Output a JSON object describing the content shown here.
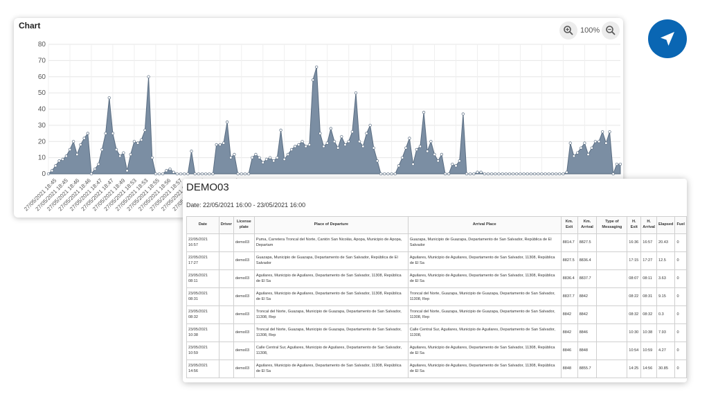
{
  "chart": {
    "title": "Chart",
    "zoom_level": "100%",
    "zoom_in_icon": "zoom-in-icon",
    "zoom_out_icon": "zoom-out-icon"
  },
  "chart_data": {
    "type": "area",
    "title": "Chart",
    "xlabel": "",
    "ylabel": "",
    "ylim": [
      0,
      80
    ],
    "yticks": [
      0,
      10,
      20,
      30,
      40,
      50,
      60,
      70,
      80
    ],
    "grid": true,
    "fill_color": "#7b8ea3",
    "line_color": "#5a6d82",
    "x_tick_labels": [
      "27/05/2021 18:45",
      "27/05/2021 18:45",
      "27/05/2021 18:46",
      "27/05/2021 18:46",
      "27/05/2021 18:47",
      "27/05/2021 18:47",
      "27/05/2021 18:49",
      "27/05/2021 18:53",
      "27/05/2021 18:53",
      "27/05/2021 18:55",
      "27/05/2021 18:56",
      "27/05/2021 18:57",
      "27/05/2021 19:01",
      "27/05/2021 19:05",
      "27/05/2021 19:09",
      "27/05/2021 19:13",
      "27/05/2021 19:17",
      "27/05/2021 19:21"
    ],
    "values": [
      0,
      2,
      5,
      8,
      9,
      11,
      15,
      20,
      12,
      18,
      22,
      25,
      0,
      3,
      6,
      15,
      25,
      47,
      25,
      15,
      11,
      13,
      2,
      12,
      20,
      19,
      21,
      27,
      60,
      10,
      0,
      0,
      0,
      2,
      3,
      1,
      0,
      0,
      0,
      0,
      14,
      0,
      0,
      0,
      0,
      0,
      0,
      18,
      18,
      19,
      32,
      10,
      12,
      0,
      0,
      0,
      0,
      10,
      12,
      10,
      7,
      9,
      10,
      8,
      10,
      27,
      9,
      12,
      15,
      17,
      18,
      20,
      17,
      18,
      58,
      66,
      25,
      17,
      19,
      28,
      20,
      16,
      23,
      18,
      20,
      26,
      50,
      20,
      17,
      25,
      30,
      16,
      8,
      0,
      0,
      0,
      0,
      0,
      5,
      10,
      16,
      22,
      6,
      15,
      17,
      38,
      14,
      20,
      12,
      8,
      12,
      0,
      0,
      6,
      5,
      8,
      37,
      0,
      0,
      0,
      1,
      1,
      0,
      0,
      0,
      0,
      0,
      0,
      0,
      0,
      0,
      0,
      0,
      0,
      0,
      0,
      0,
      0,
      0,
      0,
      0,
      0,
      0,
      0,
      0,
      1,
      19,
      11,
      13,
      16,
      19,
      12,
      16,
      20,
      20,
      26,
      19,
      26,
      0,
      6,
      6
    ]
  },
  "report": {
    "title": "DEMO03",
    "date_range": "Date: 22/05/2021 16:00 - 23/05/2021 16:00",
    "columns": [
      "Date",
      "Driver",
      "License plate",
      "Place of Departure",
      "Arrival Place",
      "Km. Exit",
      "Km. Arrival",
      "Type of Messaging",
      "H. Exit",
      "H. Arrival",
      "Elapsed",
      "Fuel"
    ],
    "rows": [
      [
        "22/05/2021 16:57",
        "",
        "demo03",
        "Puma, Carretera Troncal del Norte, Cantón San Nicolás, Apopa, Municipio de Apopa, Departam",
        "Guazapa, Municipio de Guazapa, Departamento de San Salvador, República de El Salvador",
        "8814.7",
        "8827.5",
        "",
        "16:36",
        "16:57",
        "20.43",
        "0"
      ],
      [
        "22/05/2021 17:27",
        "",
        "demo03",
        "Guazapa, Municipio de Guazapa, Departamento de San Salvador, República de El Salvador",
        "Aguilares, Municipio de Aguilares, Departamento de San Salvador, 11308, República de El Sa",
        "8827.5",
        "8836.4",
        "",
        "17:15",
        "17:27",
        "12.5",
        "0"
      ],
      [
        "23/05/2021 08:11",
        "",
        "demo03",
        "Aguilares, Municipio de Aguilares, Departamento de San Salvador, 11308, República de El Sa",
        "Aguilares, Municipio de Aguilares, Departamento de San Salvador, 11308, República de El Sa",
        "8836.4",
        "8837.7",
        "",
        "08:07",
        "08:11",
        "3.63",
        "0"
      ],
      [
        "23/05/2021 08:31",
        "",
        "demo03",
        "Aguilares, Municipio de Aguilares, Departamento de San Salvador, 11308, República de El Sa",
        "Troncal del Norte, Guazapa, Municipio de Guazapa, Departamento de San Salvador, 11308, Rep",
        "8837.7",
        "8842",
        "",
        "08:22",
        "08:31",
        "9.15",
        "0"
      ],
      [
        "23/05/2021 08:32",
        "",
        "demo03",
        "Troncal del Norte, Guazapa, Municipio de Guazapa, Departamento de San Salvador, 11308, Rep",
        "Troncal del Norte, Guazapa, Municipio de Guazapa, Departamento de San Salvador, 11308, Rep",
        "8842",
        "8842",
        "",
        "08:32",
        "08:32",
        "0.3",
        "0"
      ],
      [
        "23/05/2021 10:38",
        "",
        "demo03",
        "Troncal del Norte, Guazapa, Municipio de Guazapa, Departamento de San Salvador, 11308, Rep",
        "Calle Central Sur, Aguilares, Municipio de Aguilares, Departamento de San Salvador, 11308,",
        "8842",
        "8846",
        "",
        "10:30",
        "10:38",
        "7.93",
        "0"
      ],
      [
        "23/05/2021 10:59",
        "",
        "demo03",
        "Calle Central Sur, Aguilares, Municipio de Aguilares, Departamento de San Salvador, 11308,",
        "Aguilares, Municipio de Aguilares, Departamento de San Salvador, 11308, República de El Sa",
        "8846",
        "8848",
        "",
        "10:54",
        "10:59",
        "4.27",
        "0"
      ],
      [
        "23/05/2021 14:56",
        "",
        "demo03",
        "Aguilares, Municipio de Aguilares, Departamento de San Salvador, 11308, República de El Sa",
        "Aguilares, Municipio de Aguilares, Departamento de San Salvador, 11308, República de El Sa",
        "8848",
        "8855.7",
        "",
        "14:25",
        "14:56",
        "30.85",
        "0"
      ]
    ]
  },
  "brand": {
    "logo_icon": "navigation-arrow-icon",
    "color": "#0a66b3"
  }
}
